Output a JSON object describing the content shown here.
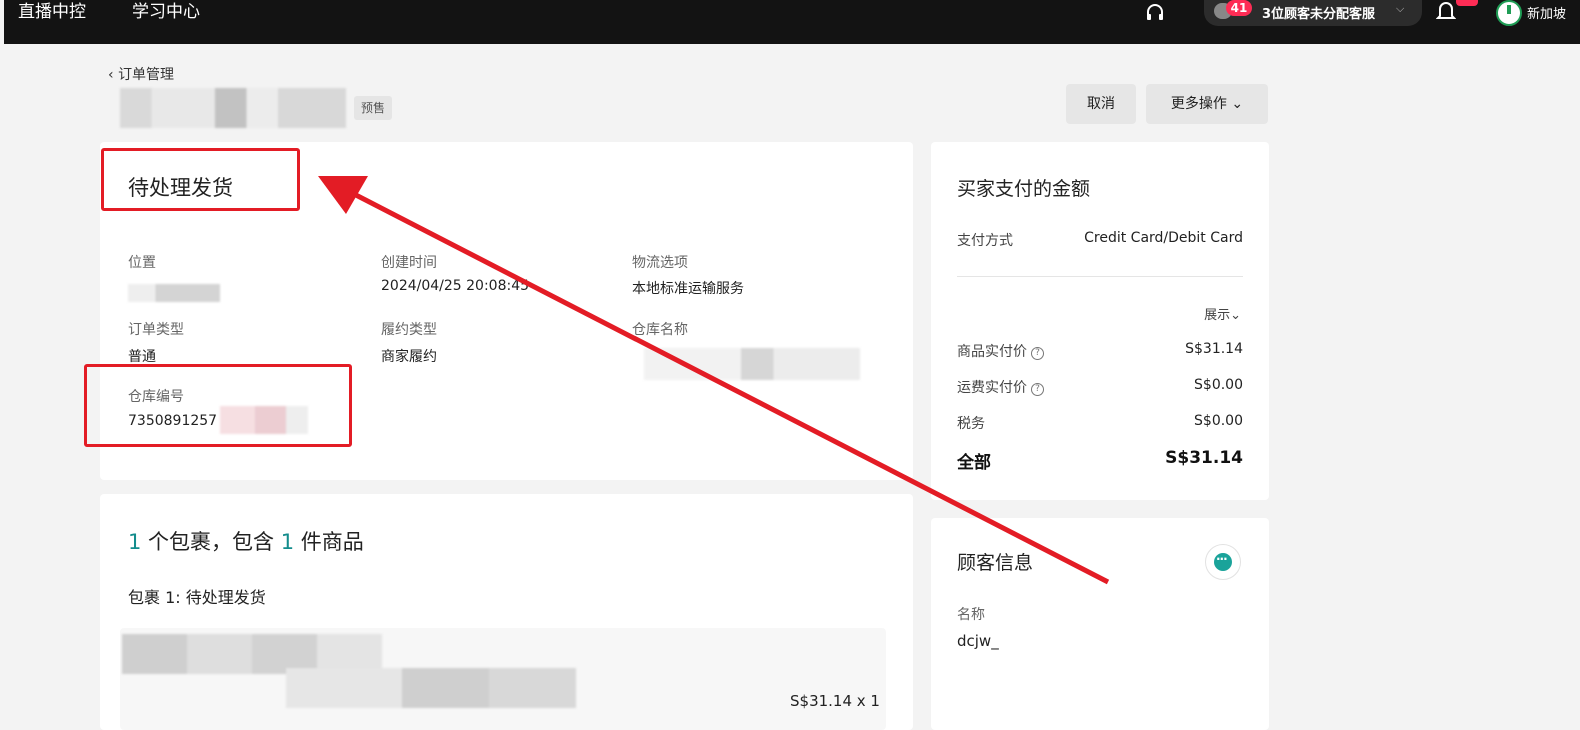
{
  "topbar": {
    "nav_live": "直播中控",
    "nav_learning": "学习中心",
    "cs_badge": "41",
    "cs_text": "3位顾客未分配客服",
    "region": "新加坡"
  },
  "header": {
    "back_label": "订单管理",
    "presale_tag": "预售",
    "cancel_button": "取消",
    "more_actions_button": "更多操作"
  },
  "status_card": {
    "title": "待处理发货",
    "fields": {
      "location_label": "位置",
      "created_label": "创建时间",
      "created_value": "2024/04/25 20:08:45",
      "logistics_label": "物流选项",
      "logistics_value": "本地标准运输服务",
      "order_type_label": "订单类型",
      "order_type_value": "普通",
      "fulfillment_label": "履约类型",
      "fulfillment_value": "商家履约",
      "warehouse_name_label": "仓库名称",
      "warehouse_id_label": "仓库编号",
      "warehouse_id_value": "7350891257"
    }
  },
  "package_card": {
    "count_packages": "1",
    "text_packages": " 个包裹，包含 ",
    "count_items": "1",
    "text_items": " 件商品",
    "package_status": "包裹 1:  待处理发货",
    "price_line": "S$31.14 x 1"
  },
  "payment_card": {
    "title": "买家支付的金额",
    "method_label": "支付方式",
    "method_value": "Credit Card/Debit Card",
    "expand_label": "展示",
    "product_label": "商品实付价",
    "product_value": "S$31.14",
    "shipping_label": "运费实付价",
    "shipping_value": "S$0.00",
    "tax_label": "税务",
    "tax_value": "S$0.00",
    "total_label": "全部",
    "total_value": "S$31.14"
  },
  "customer_card": {
    "title": "顾客信息",
    "name_label": "名称",
    "name_value": "dcjw_"
  },
  "colors": {
    "topbar": "#131313",
    "badge": "#fe2c55",
    "accent_teal": "#138c8c",
    "annotation_red": "#e31c25"
  }
}
